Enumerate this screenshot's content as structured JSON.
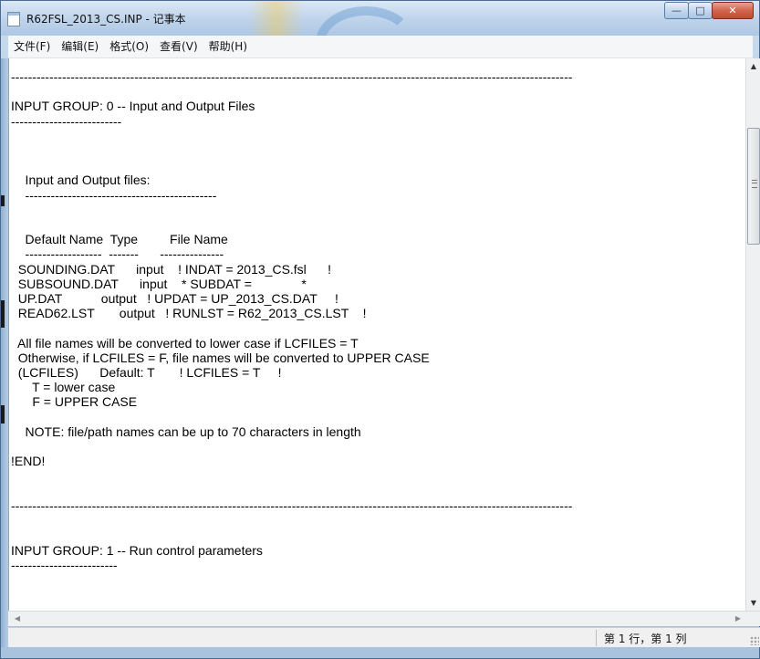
{
  "window": {
    "title": "R62FSL_2013_CS.INP - 记事本",
    "minimize_glyph": "—",
    "maximize_glyph": "□",
    "close_glyph": "✕"
  },
  "menu": {
    "items": [
      {
        "label": "文件(F)"
      },
      {
        "label": "编辑(E)"
      },
      {
        "label": "格式(O)"
      },
      {
        "label": "查看(V)"
      },
      {
        "label": "帮助(H)"
      }
    ]
  },
  "editor": {
    "content": "------------------------------------------------------------------------------------------------------------------------------------\n\nINPUT GROUP: 0 -- Input and Output Files\n--------------------------\n\n\n\n    Input and Output files:\n    ---------------------------------------------\n\n\n    Default Name  Type         File Name\n    ------------------  -------      ---------------\n  SOUNDING.DAT      input    ! INDAT = 2013_CS.fsl      !\n  SUBSOUND.DAT      input    * SUBDAT =              *\n  UP.DAT           output   ! UPDAT = UP_2013_CS.DAT     !\n  READ62.LST       output   ! RUNLST = R62_2013_CS.LST    !\n\n  All file names will be converted to lower case if LCFILES = T\n  Otherwise, if LCFILES = F, file names will be converted to UPPER CASE\n  (LCFILES)      Default: T       ! LCFILES = T     !\n      T = lower case\n      F = UPPER CASE\n\n    NOTE: file/path names can be up to 70 characters in length\n\n!END!\n\n\n------------------------------------------------------------------------------------------------------------------------------------\n\n\nINPUT GROUP: 1 -- Run control parameters\n-------------------------"
  },
  "status": {
    "position": "第 1 行，第 1 列"
  },
  "icons": {
    "scroll_up": "▲",
    "scroll_down": "▼",
    "scroll_left": "◀",
    "scroll_right": "▶"
  }
}
